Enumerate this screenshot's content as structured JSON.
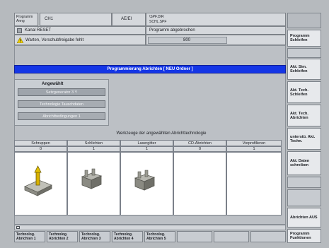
{
  "header": {
    "left_label_line1": "Programm",
    "left_label_line2": "Anng",
    "channel": "CH1",
    "mode": "AE/EI",
    "program_line1": "\\SPF.DIR",
    "program_line2": "SCHL.SPF",
    "status_text": "Programm abgebrochen",
    "reset_text": "Kanal RESET",
    "warning_text": "Warten, Vorschubfreigabe fehlt",
    "value_field": "800"
  },
  "dialog": {
    "title": "Programmierung Abrichten [ NEU Ordner ]",
    "selection_label": "Angewählt",
    "buttons": [
      "Setzgenerator 3 Y",
      "Technologie Tauschdaten",
      "Abrichtbedingungen 1"
    ],
    "table_caption": "Werkzeuge der angewählten Abrichttechnologie",
    "columns": [
      "Schruppen",
      "Schlichten",
      "Lasergitter",
      "CD-Abrichten",
      "Vorprofilieren"
    ],
    "counts": [
      "0",
      "1",
      "1",
      "0",
      "1"
    ]
  },
  "softkeys_right": [
    "",
    "Programm Schleifen",
    "",
    "Akt. Sim. Schleifen",
    "Akt. Tech. Schleifen",
    "Akt. Tech. Abrichten",
    "unterstü. Akt. Techn.",
    "Akt. Daten schreiben",
    "",
    "",
    "Abrichten AUS",
    "Programm Funktionen"
  ],
  "softkeys_bottom": [
    "Technolog. Abrichten 1",
    "Technolog. Abrichten 2",
    "Technolog. Abrichten 3",
    "Technolog. Abrichten 4",
    "Technolog. Abrichten 5",
    "",
    "",
    ""
  ],
  "icons": {
    "reset": "reset-icon",
    "warning": "warning-icon",
    "tool1": "dresser-tool-icon",
    "tool2": "wheel-profile-icon",
    "tool3": "wheel-profile-icon"
  },
  "colors": {
    "accent": "#1436e6",
    "warning": "#f0d000"
  }
}
